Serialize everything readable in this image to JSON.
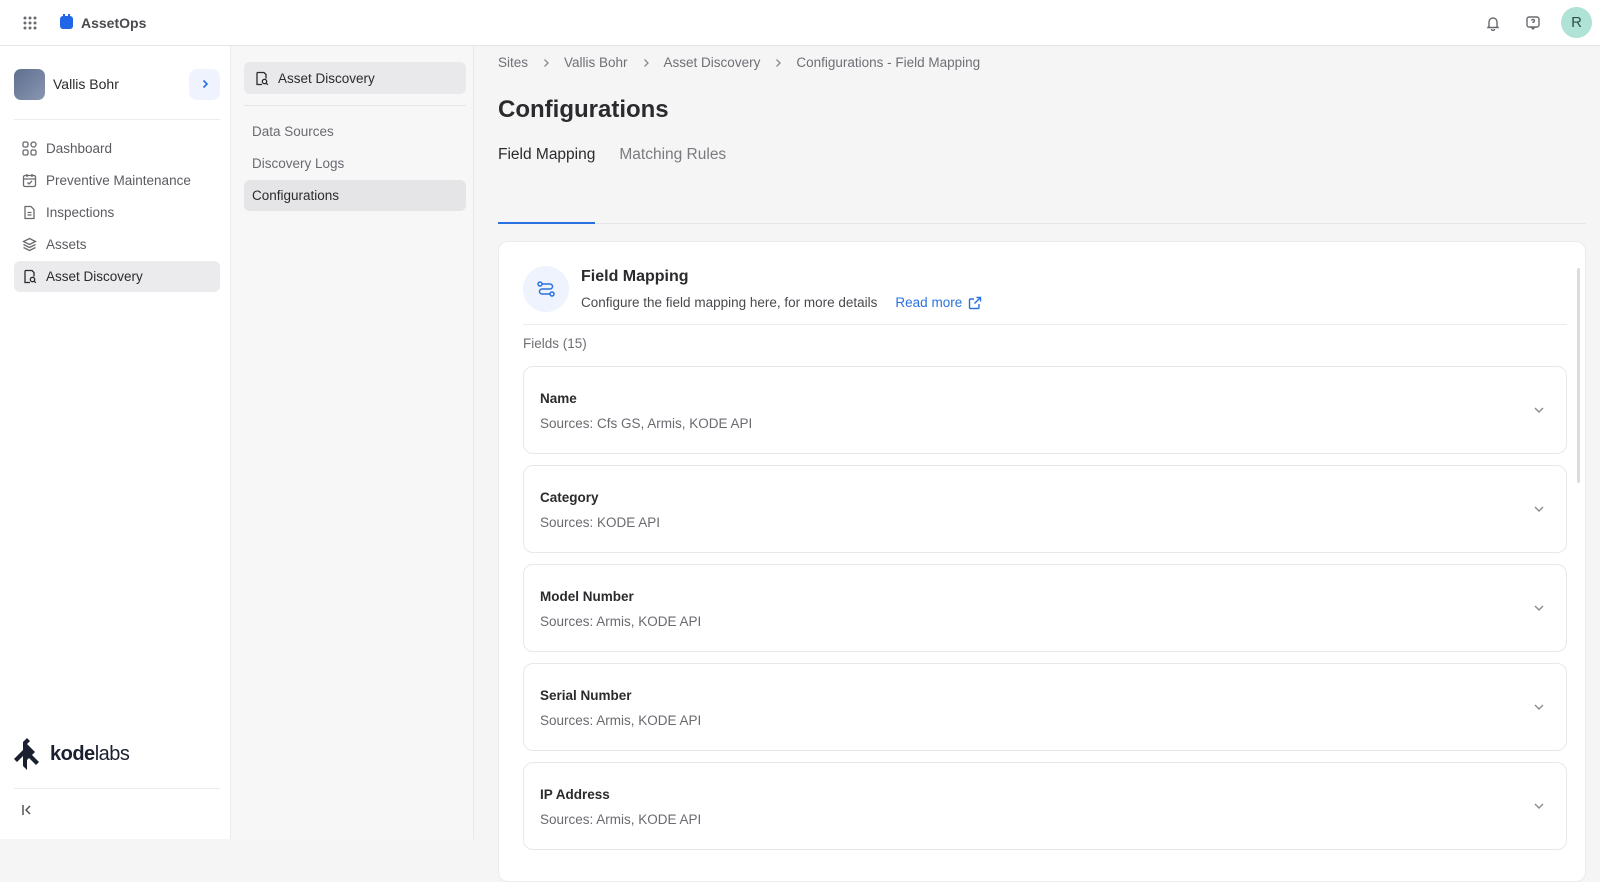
{
  "app": {
    "name": "AssetOps",
    "user_initial": "R"
  },
  "sidebar": {
    "site_name": "Vallis Bohr",
    "items": [
      {
        "label": "Dashboard",
        "icon": "dashboard-icon"
      },
      {
        "label": "Preventive Maintenance",
        "icon": "calendar-icon"
      },
      {
        "label": "Inspections",
        "icon": "document-icon"
      },
      {
        "label": "Assets",
        "icon": "layers-icon"
      },
      {
        "label": "Asset Discovery",
        "icon": "asset-discovery-icon",
        "active": true
      }
    ],
    "brand_prefix": "kode",
    "brand_suffix": "labs"
  },
  "subnav": {
    "header": "Asset Discovery",
    "items": [
      {
        "label": "Data Sources"
      },
      {
        "label": "Discovery Logs"
      },
      {
        "label": "Configurations",
        "active": true
      }
    ]
  },
  "breadcrumb": [
    "Sites",
    "Vallis Bohr",
    "Asset Discovery",
    "Configurations - Field Mapping"
  ],
  "page": {
    "title": "Configurations",
    "tabs": [
      {
        "label": "Field Mapping",
        "active": true
      },
      {
        "label": "Matching Rules"
      }
    ]
  },
  "card": {
    "title": "Field Mapping",
    "description": "Configure the field mapping here, for more details",
    "read_more": "Read more",
    "fields_count_label": "Fields (15)",
    "fields": [
      {
        "name": "Name",
        "sources": "Sources: Cfs GS, Armis, KODE API"
      },
      {
        "name": "Category",
        "sources": "Sources: KODE API"
      },
      {
        "name": "Model Number",
        "sources": "Sources: Armis, KODE API"
      },
      {
        "name": "Serial Number",
        "sources": "Sources: Armis, KODE API"
      },
      {
        "name": "IP Address",
        "sources": "Sources: Armis, KODE API"
      }
    ]
  },
  "colors": {
    "accent": "#2a72df",
    "brand": "#2266e8",
    "avatar": "#aee3d5"
  }
}
